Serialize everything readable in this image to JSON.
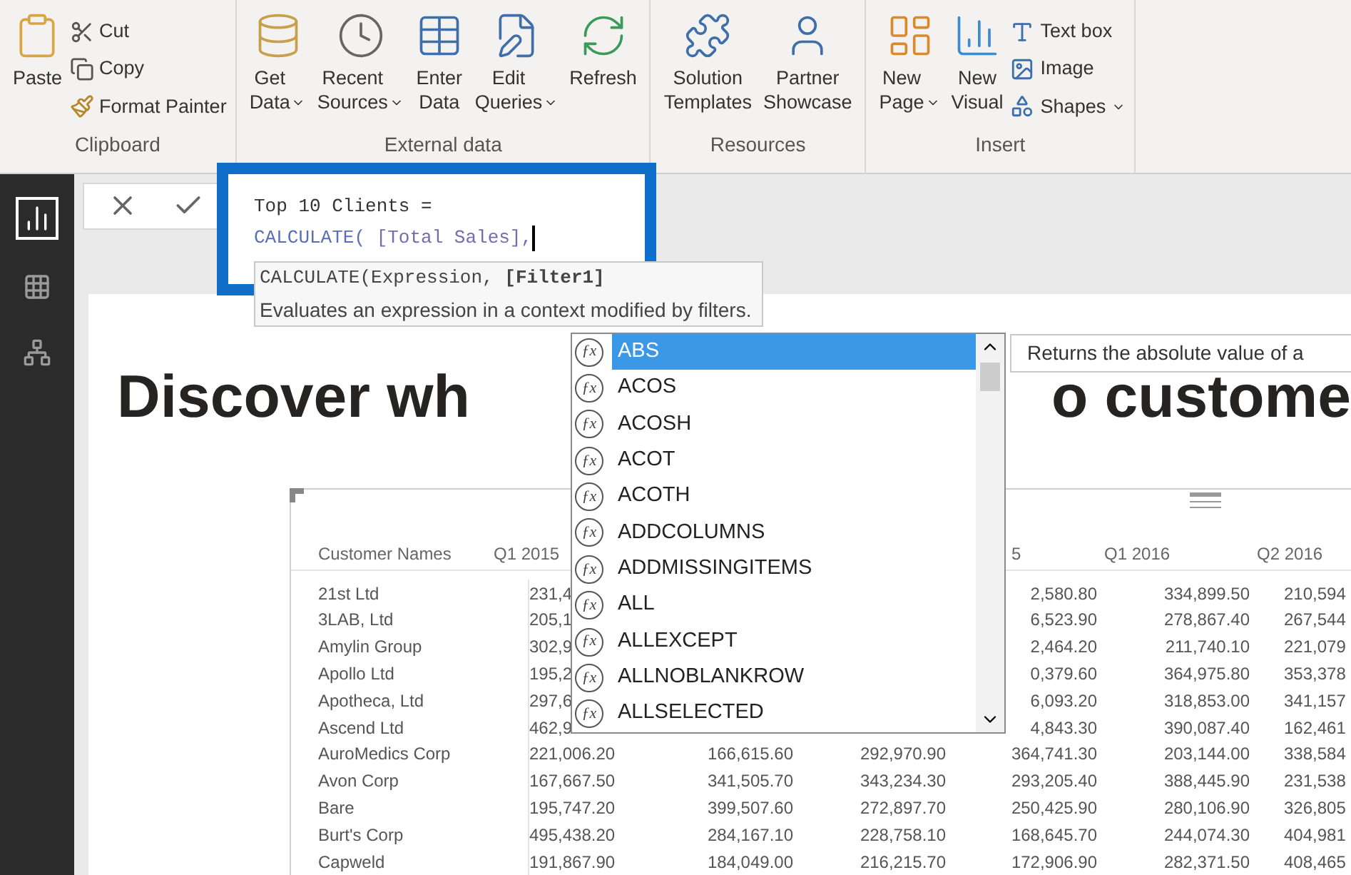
{
  "ribbon": {
    "groups": [
      {
        "label": "Clipboard",
        "items": [
          {
            "label": "Paste",
            "kind": "large",
            "dropdown": false
          },
          {
            "label": "Cut",
            "kind": "small",
            "dropdown": false
          },
          {
            "label": "Copy",
            "kind": "small",
            "dropdown": false
          },
          {
            "label": "Format Painter",
            "kind": "small",
            "dropdown": false
          }
        ]
      },
      {
        "label": "External data",
        "items": [
          {
            "label": "Get Data",
            "kind": "large",
            "dropdown": true
          },
          {
            "label": "Recent Sources",
            "kind": "large",
            "dropdown": true
          },
          {
            "label": "Enter Data",
            "kind": "large",
            "dropdown": false
          },
          {
            "label": "Edit Queries",
            "kind": "large",
            "dropdown": true
          },
          {
            "label": "Refresh",
            "kind": "large",
            "dropdown": false
          }
        ]
      },
      {
        "label": "Resources",
        "items": [
          {
            "label": "Solution Templates",
            "kind": "large",
            "dropdown": false
          },
          {
            "label": "Partner Showcase",
            "kind": "large",
            "dropdown": false
          }
        ]
      },
      {
        "label": "Insert",
        "items": [
          {
            "label": "New Page",
            "kind": "large",
            "dropdown": true
          },
          {
            "label": "New Visual",
            "kind": "large",
            "dropdown": false
          },
          {
            "label": "Text box",
            "kind": "small",
            "dropdown": false
          },
          {
            "label": "Image",
            "kind": "small",
            "dropdown": false
          },
          {
            "label": "Shapes",
            "kind": "small",
            "dropdown": true
          }
        ]
      }
    ]
  },
  "sidebar": {
    "items": [
      {
        "selected": true
      },
      {
        "selected": false
      },
      {
        "selected": false
      }
    ]
  },
  "formula": {
    "lines": [
      [
        {
          "text": "Top 10 Clients =",
          "kind": "plain"
        }
      ],
      [
        {
          "text": "CALCULATE(",
          "kind": "function"
        },
        {
          "text": " [Total Sales],",
          "kind": "measure"
        }
      ]
    ],
    "signature": "CALCULATE(Expression, **[Filter1]**",
    "description": "Evaluates an expression in a context modified by filters."
  },
  "autocomplete": {
    "items": [
      {
        "icon": "ƒx",
        "label": "ABS",
        "selected": true
      },
      {
        "icon": "ƒx",
        "label": "ACOS",
        "selected": false
      },
      {
        "icon": "ƒx",
        "label": "ACOSH",
        "selected": false
      },
      {
        "icon": "ƒx",
        "label": "ACOT",
        "selected": false
      },
      {
        "icon": "ƒx",
        "label": "ACOTH",
        "selected": false
      },
      {
        "icon": "ƒx",
        "label": "ADDCOLUMNS",
        "selected": false
      },
      {
        "icon": "ƒx",
        "label": "ADDMISSINGITEMS",
        "selected": false
      },
      {
        "icon": "ƒx",
        "label": "ALL",
        "selected": false
      },
      {
        "icon": "ƒx",
        "label": "ALLEXCEPT",
        "selected": false
      },
      {
        "icon": "ƒx",
        "label": "ALLNOBLANKROW",
        "selected": false
      },
      {
        "icon": "ƒx",
        "label": "ALLSELECTED",
        "selected": false
      }
    ],
    "tooltip": "Returns the absolute value of a"
  },
  "title": [
    "Discover wh",
    "o custome"
  ],
  "table": {
    "columns": [
      "Customer Names",
      "Q1 2015",
      null,
      null,
      "5",
      "Q1 2016",
      "Q2 2016"
    ],
    "rows": [
      [
        "21st Ltd",
        "231,4",
        null,
        null,
        "2,580.80",
        "334,899.50",
        "210,594"
      ],
      [
        "3LAB, Ltd",
        "205,1",
        null,
        null,
        "6,523.90",
        "278,867.40",
        "267,544"
      ],
      [
        "Amylin Group",
        "302,9",
        null,
        null,
        "2,464.20",
        "211,740.10",
        "221,079"
      ],
      [
        "Apollo Ltd",
        "195,2",
        null,
        null,
        "0,379.60",
        "364,975.80",
        "353,378"
      ],
      [
        "Apotheca, Ltd",
        "297,6",
        null,
        null,
        "6,093.20",
        "318,853.00",
        "341,157"
      ],
      [
        "Ascend Ltd",
        "462,9",
        null,
        null,
        "4,843.30",
        "390,087.40",
        "162,461"
      ],
      [
        "AuroMedics Corp",
        "221,006.20",
        "166,615.60",
        "292,970.90",
        "364,741.30",
        "203,144.00",
        "338,584"
      ],
      [
        "Avon Corp",
        "167,667.50",
        "341,505.70",
        "343,234.30",
        "293,205.40",
        "388,445.90",
        "231,538"
      ],
      [
        "Bare",
        "195,747.20",
        "399,507.60",
        "272,897.70",
        "250,425.90",
        "280,106.90",
        "326,805"
      ],
      [
        "Burt's Corp",
        "495,438.20",
        "284,167.10",
        "228,758.10",
        "168,645.70",
        "244,074.30",
        "404,981"
      ],
      [
        "Capweld",
        "191,867.90",
        "184,049.00",
        "216,215.70",
        "172,906.90",
        "282,371.50",
        "408,465"
      ]
    ]
  }
}
